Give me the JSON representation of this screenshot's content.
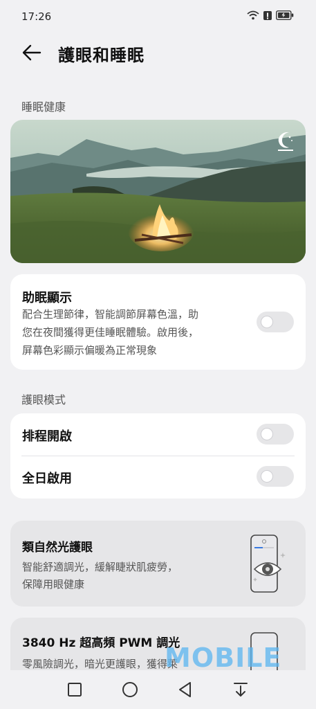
{
  "status_bar": {
    "time": "17:26"
  },
  "header": {
    "title": "護眼和睡眠"
  },
  "sections": {
    "sleep_health": "睡眠健康",
    "eye_mode": "護眼模式"
  },
  "sleep_display": {
    "title": "助眠顯示",
    "description_lines": [
      "配合生理節律，智能調節屏幕色溫，助",
      "您在夜間獲得更佳睡眠體驗。啟用後，",
      "屏幕色彩顯示偏暖為正常現象"
    ],
    "enabled": false
  },
  "eye_mode": {
    "schedule_label": "排程開啟",
    "schedule_enabled": false,
    "all_day_label": "全日啟用",
    "all_day_enabled": false
  },
  "promo_natural": {
    "title": "類自然光護眼",
    "description_lines": [
      "智能舒適調光，緩解睫狀肌疲勞，",
      "保障用眼健康"
    ]
  },
  "promo_pwm": {
    "title": "3840 Hz 超高頻 PWM 調光",
    "description_lines": [
      "零風險調光，暗光更護眼，獲得萊"
    ]
  },
  "watermark": "MOBILE",
  "colors": {
    "background": "#f1f1f3",
    "card": "#ffffff",
    "promo": "#e6e6e8",
    "watermark": "#5ab4f0"
  }
}
